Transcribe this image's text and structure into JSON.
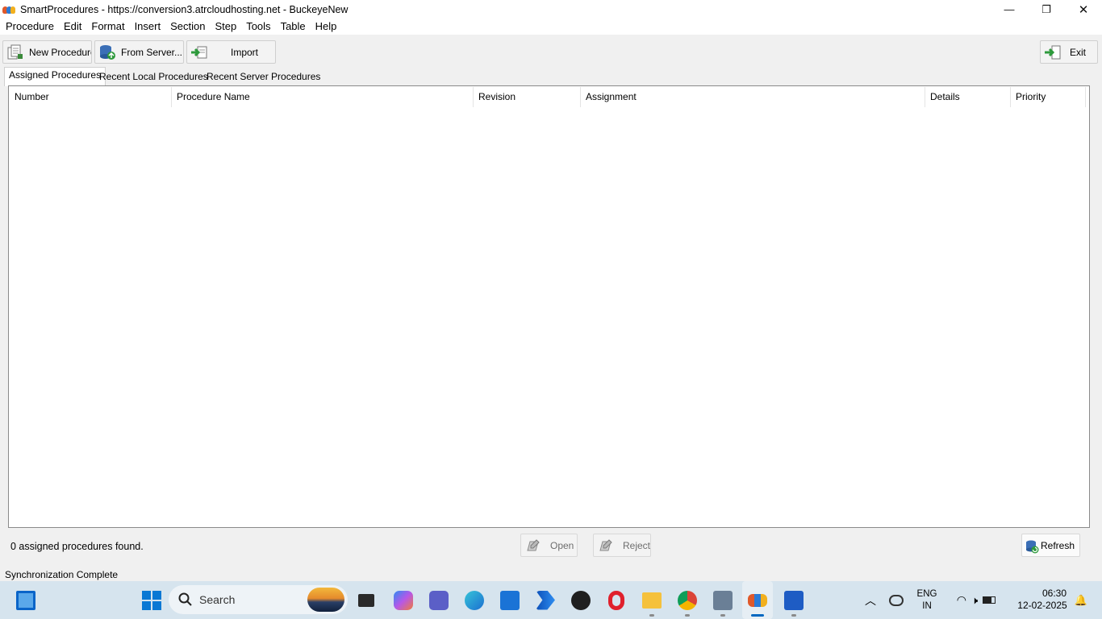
{
  "window": {
    "title": "SmartProcedures - https://conversion3.atrcloudhosting.net - BuckeyeNew",
    "minimize_glyph": "—",
    "maximize_glyph": "❐",
    "close_glyph": "✕"
  },
  "menu": [
    "Procedure",
    "Edit",
    "Format",
    "Insert",
    "Section",
    "Step",
    "Tools",
    "Table",
    "Help"
  ],
  "toolbar": {
    "new_procedure": "New Procedure",
    "from_server": "From Server...",
    "import": "Import",
    "exit": "Exit"
  },
  "tabs": [
    "Assigned Procedures",
    "Recent Local Procedures",
    "Recent Server Procedures"
  ],
  "active_tab": "Assigned Procedures",
  "table": {
    "columns": [
      "Number",
      "Procedure Name",
      "Revision",
      "Assignment",
      "Details",
      "Priority"
    ],
    "rows": []
  },
  "footer": {
    "found_text": "0 assigned procedures found.",
    "open": "Open",
    "reject": "Reject",
    "refresh": "Refresh"
  },
  "status": "Synchronization Complete",
  "taskbar": {
    "search_label": "Search",
    "lang_line1": "ENG",
    "lang_line2": "IN",
    "time": "06:30",
    "date": "12-02-2025",
    "apps": [
      "start-icon",
      "widgets-icon",
      "task-view-icon",
      "copilot-icon",
      "teams-icon",
      "edge-icon",
      "store-icon",
      "power-automate-icon",
      "dell-icon",
      "opera-icon",
      "file-explorer-icon",
      "chrome-icon",
      "contacts-icon",
      "smartprocedures-icon",
      "word-icon"
    ]
  },
  "colors": {
    "accent_blue": "#0067c0",
    "taskbar": "#d6e4ee",
    "app_chrome": "#f0f0f0"
  }
}
